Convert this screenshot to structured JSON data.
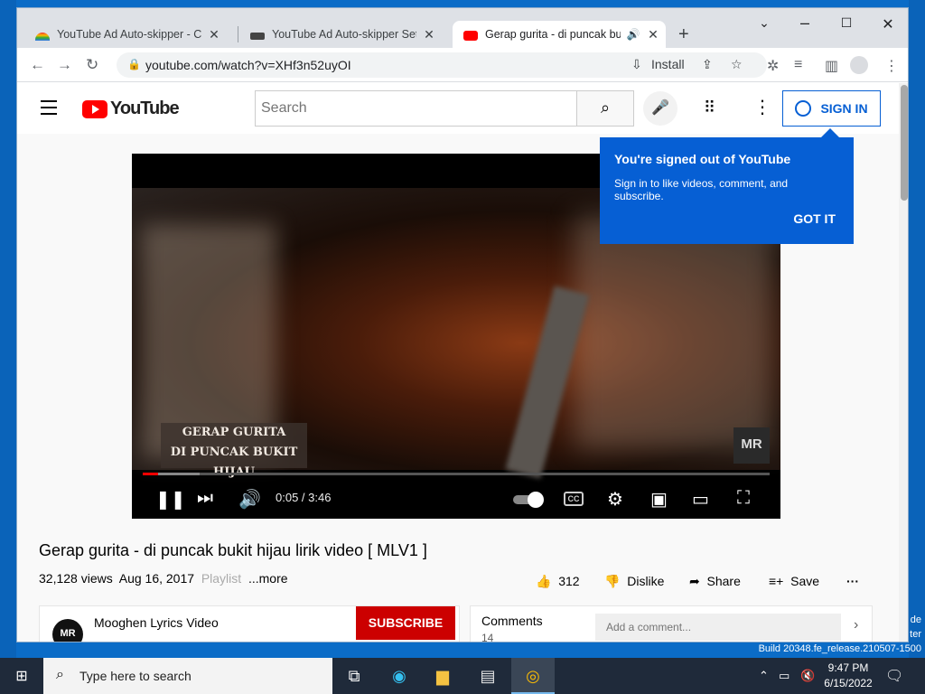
{
  "browser": {
    "tabs": [
      {
        "title": "YouTube Ad Auto-skipper - Chro",
        "favicon": "rainbow-icon"
      },
      {
        "title": "YouTube Ad Auto-skipper Setting",
        "favicon": "extension-icon"
      },
      {
        "title": "Gerap gurita - di puncak buk",
        "favicon": "youtube-icon",
        "active": true
      }
    ],
    "url": "youtube.com/watch?v=XHf3n52uyOI",
    "install_label": "Install"
  },
  "youtube": {
    "logo_text": "YouTube",
    "search_placeholder": "Search",
    "sign_in_label": "SIGN IN",
    "popup": {
      "title": "You're signed out of YouTube",
      "body": "Sign in to like videos, comment, and subscribe.",
      "button": "GOT IT"
    },
    "player": {
      "lyric_line1": "GERAP GURITA",
      "lyric_line2": "DI PUNCAK BUKIT HIJAU",
      "watermark": "MR",
      "time": "0:05 / 3:46",
      "progress_fraction": 0.022,
      "cc_label": "CC"
    },
    "video": {
      "title": "Gerap gurita - di puncak bukit hijau lirik video [ MLV1 ]",
      "views": "32,128 views",
      "date": "Aug 16, 2017",
      "playlist": "Playlist",
      "more": "...more",
      "likes": "312",
      "dislike_label": "Dislike",
      "share_label": "Share",
      "save_label": "Save"
    },
    "channel": {
      "name": "Mooghen Lyrics Video",
      "subscribe_label": "SUBSCRIBE",
      "avatar_text": "MR"
    },
    "comments": {
      "label": "Comments",
      "count": "14",
      "placeholder": "Add a comment..."
    }
  },
  "taskbar": {
    "search_placeholder": "Type here to search",
    "time": "9:47 PM",
    "date": "6/15/2022"
  },
  "desktop": {
    "build_text": "Build 20348.fe_release.210507-1500",
    "side_text_1": "de",
    "side_text_2": "ter"
  }
}
